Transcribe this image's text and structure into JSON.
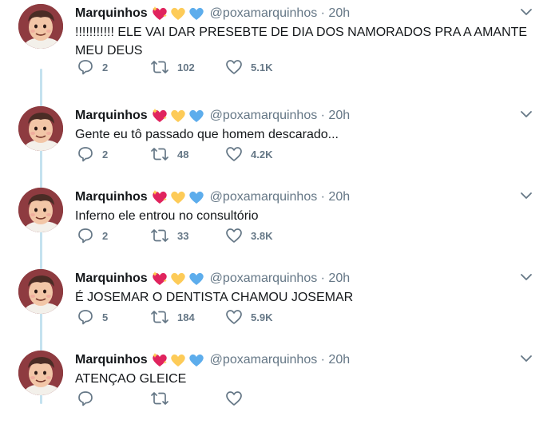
{
  "tweets": [
    {
      "name": "Marquinhos",
      "handle": "@poxamarquinhos · 20h",
      "text": "!!!!!!!!!!! ELE VAI DAR PRESEBTE DE DIA DOS NAMORADOS PRA A AMANTE MEU DEUS",
      "replies": "2",
      "retweets": "102",
      "likes": "5.1K"
    },
    {
      "name": "Marquinhos",
      "handle": "@poxamarquinhos · 20h",
      "text": "Gente eu tô passado que homem descarado...",
      "replies": "2",
      "retweets": "48",
      "likes": "4.2K"
    },
    {
      "name": "Marquinhos",
      "handle": "@poxamarquinhos · 20h",
      "text": "Inferno ele entrou no consultório",
      "replies": "2",
      "retweets": "33",
      "likes": "3.8K"
    },
    {
      "name": "Marquinhos",
      "handle": "@poxamarquinhos · 20h",
      "text": "É JOSEMAR O DENTISTA CHAMOU JOSEMAR",
      "replies": "5",
      "retweets": "184",
      "likes": "5.9K"
    },
    {
      "name": "Marquinhos",
      "handle": "@poxamarquinhos · 20h",
      "text": "ATENÇAO GLEICE",
      "replies": "",
      "retweets": "",
      "likes": ""
    }
  ],
  "emojis": [
    "sparkling-heart",
    "yellow-heart",
    "blue-heart"
  ],
  "colors": {
    "thread_line": "#c4e2ef",
    "secondary_text": "#657786",
    "primary_text": "#14171a"
  }
}
